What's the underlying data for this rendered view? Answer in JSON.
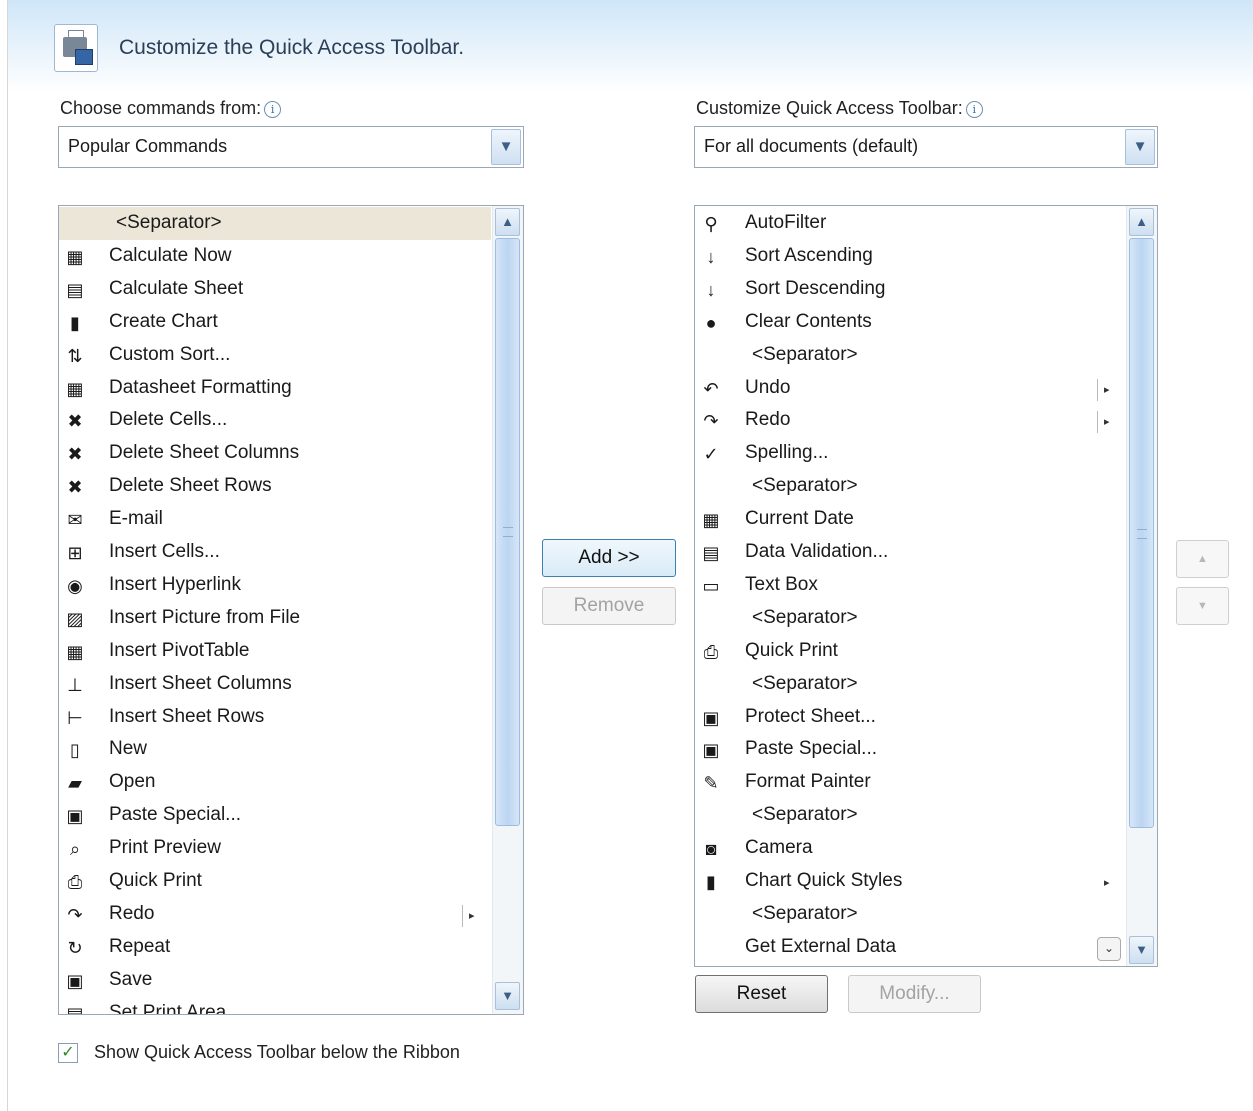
{
  "dialog": {
    "title": "Customize the Quick Access Toolbar."
  },
  "choose": {
    "label": "Choose commands from:",
    "info": "i",
    "value": "Popular Commands",
    "items": [
      {
        "label": "<Separator>",
        "icon": "",
        "icon_name": "separator",
        "selected": true
      },
      {
        "label": "Calculate Now",
        "icon": "▦",
        "icon_name": "calculator-icon"
      },
      {
        "label": "Calculate Sheet",
        "icon": "▤",
        "icon_name": "calculate-sheet-icon"
      },
      {
        "label": "Create Chart",
        "icon": "▮",
        "icon_name": "chart-icon"
      },
      {
        "label": "Custom Sort...",
        "icon": "⇅",
        "icon_name": "custom-sort-icon"
      },
      {
        "label": "Datasheet Formatting",
        "icon": "▦",
        "icon_name": "datasheet-icon"
      },
      {
        "label": "Delete Cells...",
        "icon": "✖",
        "icon_name": "delete-cells-icon"
      },
      {
        "label": "Delete Sheet Columns",
        "icon": "✖",
        "icon_name": "delete-columns-icon"
      },
      {
        "label": "Delete Sheet Rows",
        "icon": "✖",
        "icon_name": "delete-rows-icon"
      },
      {
        "label": "E-mail",
        "icon": "✉",
        "icon_name": "email-icon"
      },
      {
        "label": "Insert Cells...",
        "icon": "⊞",
        "icon_name": "insert-cells-icon"
      },
      {
        "label": "Insert Hyperlink",
        "icon": "◉",
        "icon_name": "hyperlink-icon"
      },
      {
        "label": "Insert Picture from File",
        "icon": "▨",
        "icon_name": "picture-icon"
      },
      {
        "label": "Insert PivotTable",
        "icon": "▦",
        "icon_name": "pivot-table-icon"
      },
      {
        "label": "Insert Sheet Columns",
        "icon": "⊥",
        "icon_name": "insert-columns-icon"
      },
      {
        "label": "Insert Sheet Rows",
        "icon": "⊢",
        "icon_name": "insert-rows-icon"
      },
      {
        "label": "New",
        "icon": "▯",
        "icon_name": "new-document-icon"
      },
      {
        "label": "Open",
        "icon": "▰",
        "icon_name": "open-folder-icon"
      },
      {
        "label": "Paste Special...",
        "icon": "▣",
        "icon_name": "paste-special-icon"
      },
      {
        "label": "Print Preview",
        "icon": "⌕",
        "icon_name": "print-preview-icon"
      },
      {
        "label": "Quick Print",
        "icon": "⎙",
        "icon_name": "printer-icon"
      },
      {
        "label": "Redo",
        "icon": "↷",
        "icon_name": "redo-icon",
        "submenu": "bar"
      },
      {
        "label": "Repeat",
        "icon": "↻",
        "icon_name": "repeat-icon"
      },
      {
        "label": "Save",
        "icon": "▣",
        "icon_name": "save-icon"
      },
      {
        "label": "Set Print Area",
        "icon": "▤",
        "icon_name": "print-area-icon"
      }
    ]
  },
  "toolbar": {
    "label": "Customize Quick Access Toolbar:",
    "info": "i",
    "value": "For all documents (default)",
    "items": [
      {
        "label": "AutoFilter",
        "icon": "⚲",
        "icon_name": "filter-icon"
      },
      {
        "label": "Sort Ascending",
        "icon": "↓",
        "icon_name": "sort-ascending-icon"
      },
      {
        "label": "Sort Descending",
        "icon": "↓",
        "icon_name": "sort-descending-icon"
      },
      {
        "label": "Clear Contents",
        "icon": "●",
        "icon_name": "clear-contents-icon"
      },
      {
        "label": "<Separator>",
        "icon": "",
        "icon_name": "separator"
      },
      {
        "label": "Undo",
        "icon": "↶",
        "icon_name": "undo-icon",
        "submenu": "bar"
      },
      {
        "label": "Redo",
        "icon": "↷",
        "icon_name": "redo-icon",
        "submenu": "bar"
      },
      {
        "label": "Spelling...",
        "icon": "✓",
        "icon_name": "spelling-icon"
      },
      {
        "label": "<Separator>",
        "icon": "",
        "icon_name": "separator"
      },
      {
        "label": "Current Date",
        "icon": "▦",
        "icon_name": "calendar-icon"
      },
      {
        "label": "Data Validation...",
        "icon": "▤",
        "icon_name": "data-validation-icon"
      },
      {
        "label": "Text Box",
        "icon": "▭",
        "icon_name": "text-box-icon"
      },
      {
        "label": "<Separator>",
        "icon": "",
        "icon_name": "separator"
      },
      {
        "label": "Quick Print",
        "icon": "⎙",
        "icon_name": "printer-icon"
      },
      {
        "label": "<Separator>",
        "icon": "",
        "icon_name": "separator"
      },
      {
        "label": "Protect Sheet...",
        "icon": "▣",
        "icon_name": "protect-sheet-icon"
      },
      {
        "label": "Paste Special...",
        "icon": "▣",
        "icon_name": "paste-special-icon"
      },
      {
        "label": "Format Painter",
        "icon": "✎",
        "icon_name": "format-painter-icon"
      },
      {
        "label": "<Separator>",
        "icon": "",
        "icon_name": "separator"
      },
      {
        "label": "Camera",
        "icon": "◙",
        "icon_name": "camera-icon"
      },
      {
        "label": "Chart Quick Styles",
        "icon": "▮",
        "icon_name": "chart-styles-icon",
        "submenu": "arrow"
      },
      {
        "label": "<Separator>",
        "icon": "",
        "icon_name": "separator"
      },
      {
        "label": "Get External Data",
        "icon": "",
        "icon_name": "external-data-icon"
      }
    ]
  },
  "buttons": {
    "add": "Add >>",
    "remove": "Remove",
    "reset": "Reset",
    "modify": "Modify...",
    "move_up": "▲",
    "move_down": "▼"
  },
  "checkbox": {
    "label": "Show Quick Access Toolbar below the Ribbon",
    "checked": true,
    "mark": "✓"
  },
  "glyphs": {
    "dropdown": "▼",
    "scroll_up": "▲",
    "scroll_down": "▼",
    "submenu": "▸",
    "expand": "⌄"
  }
}
